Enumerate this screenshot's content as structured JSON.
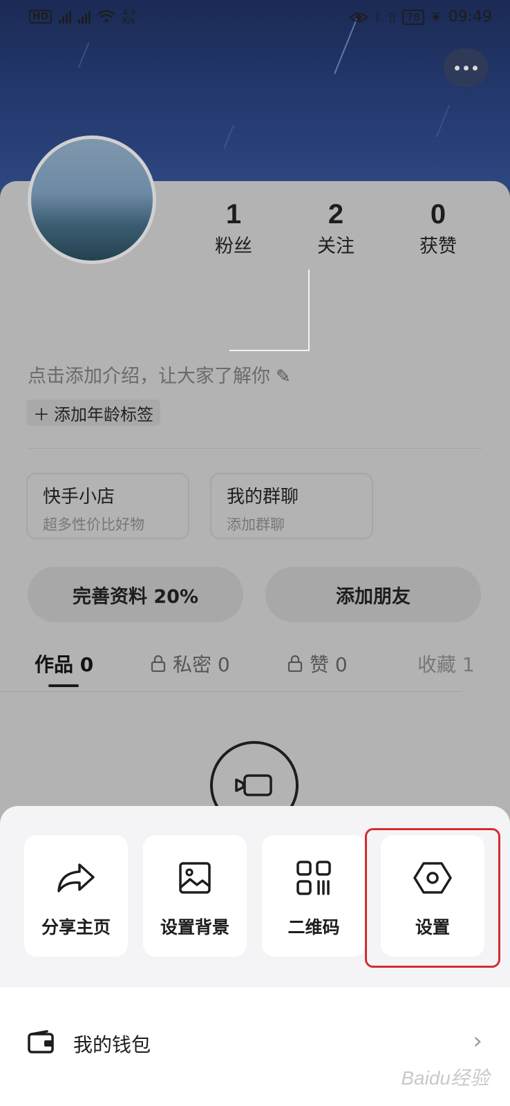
{
  "status_bar": {
    "left_badge": "HD",
    "net_speed_top": "4.9",
    "net_speed_bottom": "K/s",
    "battery": "78",
    "time": "09:49"
  },
  "profile": {
    "stats": [
      {
        "value": "1",
        "label": "粉丝"
      },
      {
        "value": "2",
        "label": "关注"
      },
      {
        "value": "0",
        "label": "获赞"
      }
    ],
    "intro_placeholder": "点击添加介绍，让大家了解你",
    "age_tag": "添加年龄标签",
    "features": [
      {
        "title": "快手小店",
        "subtitle": "超多性价比好物"
      },
      {
        "title": "我的群聊",
        "subtitle": "添加群聊"
      }
    ],
    "complete_profile": "完善资料 20%",
    "add_friends": "添加朋友"
  },
  "tabs": [
    {
      "label": "作品 0",
      "locked": false
    },
    {
      "label": "私密 0",
      "locked": true
    },
    {
      "label": "赞 0",
      "locked": true
    },
    {
      "label": "收藏 1",
      "locked": false
    }
  ],
  "sheet": {
    "actions": [
      {
        "label": "分享主页",
        "icon": "share-icon"
      },
      {
        "label": "设置背景",
        "icon": "image-icon"
      },
      {
        "label": "二维码",
        "icon": "qr-code-icon"
      },
      {
        "label": "设置",
        "icon": "settings-icon"
      }
    ],
    "wallet_label": "我的钱包"
  },
  "watermark": "Baidu经验",
  "colors": {
    "highlight": "#d62b30",
    "header_bg": "#23386d"
  }
}
